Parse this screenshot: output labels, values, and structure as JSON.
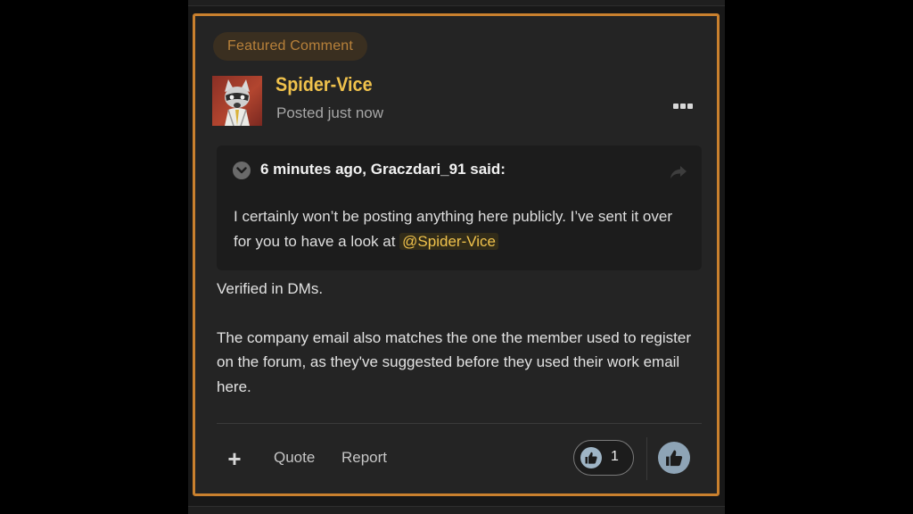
{
  "post": {
    "badge": "Featured Comment",
    "author": "Spider-Vice",
    "posted": "Posted just now",
    "quote": {
      "attribution": "6 minutes ago, Graczdari_91 said:",
      "text": "I certainly won’t be posting anything here publicly. I’ve sent it over for you to have a look at ",
      "mention": "@Spider-Vice"
    },
    "body": [
      "Verified in DMs.",
      "The company email also matches the one the member used to register on the forum, as they've suggested before they used their work email here."
    ]
  },
  "footer": {
    "add_label": "+",
    "quote_label": "Quote",
    "report_label": "Report",
    "like_count": "1"
  },
  "icons": {
    "more": "more-options-icon",
    "collapse": "chevron-down-icon",
    "share": "share-icon",
    "like": "thumbs-up-icon"
  },
  "colors": {
    "accent_border": "#c9802e",
    "author_name": "#f0c24c",
    "mention": "#f0c24c",
    "reaction": "#8ea4b6"
  }
}
